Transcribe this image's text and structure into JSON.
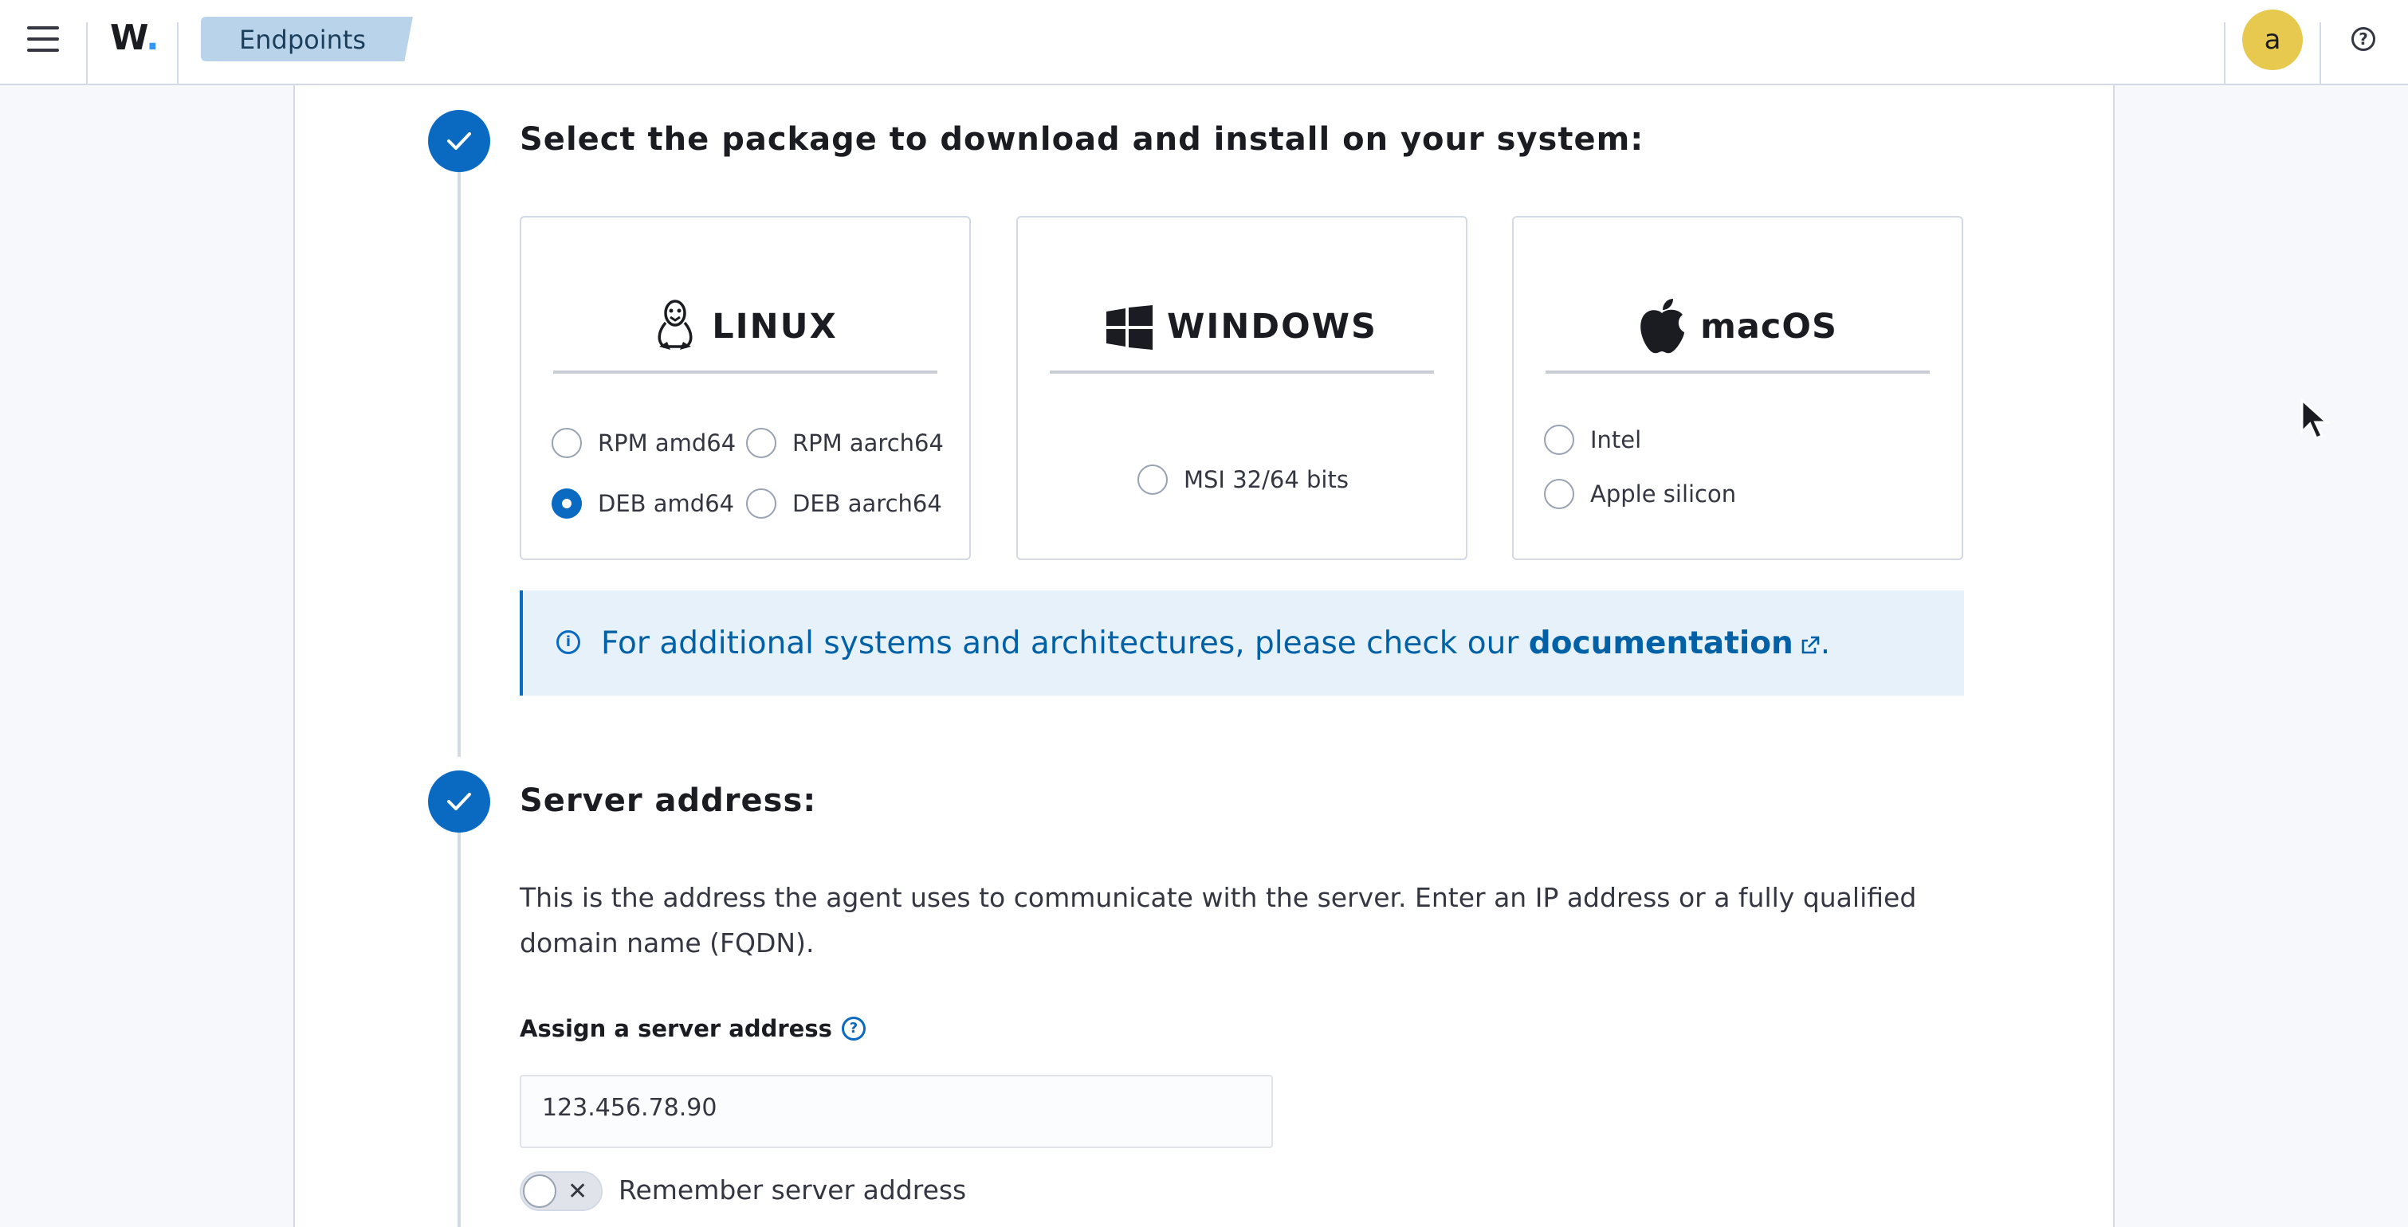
{
  "header": {
    "logo_text": "W",
    "logo_dot": ".",
    "breadcrumb": "Endpoints",
    "avatar_initial": "a",
    "help_icon": "question-circle-icon",
    "menu_icon": "hamburger-menu-icon"
  },
  "step1": {
    "title": "Select the package to download and install on your system:",
    "cards": [
      {
        "title": "LINUX",
        "icon": "linux-penguin-icon"
      },
      {
        "title": "WINDOWS",
        "icon": "windows-logo-icon"
      },
      {
        "title": "macOS",
        "icon": "apple-logo-icon"
      }
    ],
    "linux_options": [
      {
        "label": "RPM amd64",
        "checked": false
      },
      {
        "label": "RPM aarch64",
        "checked": false
      },
      {
        "label": "DEB amd64",
        "checked": true
      },
      {
        "label": "DEB aarch64",
        "checked": false
      }
    ],
    "windows_options": [
      {
        "label": "MSI 32/64 bits",
        "checked": false
      }
    ],
    "macos_options": [
      {
        "label": "Intel",
        "checked": false
      },
      {
        "label": "Apple silicon",
        "checked": false
      }
    ],
    "callout_text": "For additional systems and architectures, please check our ",
    "callout_link": "documentation",
    "callout_end": "."
  },
  "step2": {
    "title": "Server address:",
    "description": "This is the address the agent uses to communicate with the server. Enter an IP address or a fully qualified domain name (FQDN).",
    "field_label": "Assign a server address",
    "field_value": "123.456.78.90",
    "toggle_label": "Remember server address",
    "toggle_on": false
  },
  "colors": {
    "accent": "#0a6ac2",
    "callout_bg": "#e6f1fa",
    "avatar_bg": "#e7c94f",
    "breadcrumb_bg": "#b9d4ea"
  }
}
